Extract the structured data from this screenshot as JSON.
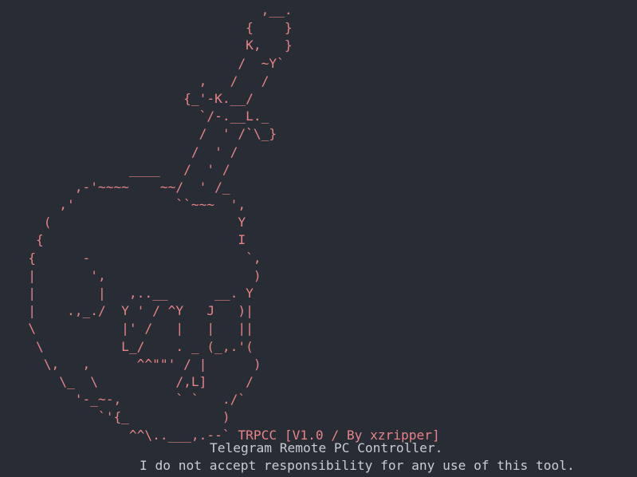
{
  "colors": {
    "background": "#282c34",
    "art": "#e88388",
    "text": "#c8ccd4"
  },
  "banner": {
    "art_lines": [
      "                                 ,__.",
      "                               {    }",
      "                               K,   }",
      "                              /  ~Y`",
      "                         ,   /   /",
      "                       {_'-K.__/",
      "                         `/-.__L._",
      "                         /  ' /`\\_}",
      "                        /  ' /",
      "                ____   /  ' /",
      "         ,-'~~~~    ~~/  ' /_",
      "       ,'             ``~~~  ',",
      "     (                        Y",
      "    {                         I",
      "   {      -                    `,",
      "   |       ',                   )",
      "   |        |   ,..__      __. Y",
      "   |    .,_./  Y ' / ^Y   J   )|",
      "   \\           |' /   |   |   ||",
      "    \\          L_/    . _ (_,.'(",
      "     \\,   ,      ^^\"\"' / |      )",
      "       \\_  \\          /,L]     /",
      "         '-_~-,       ` `   ./`",
      "            `'{_            )"
    ],
    "title_art": "                ^^\\..___,.--`",
    "title_text": " TRPCC [V1.0 / By xzripper]",
    "subtitle": "Telegram Remote PC Controller.",
    "disclaimer": "I do not accept responsibility for any use of this tool."
  }
}
